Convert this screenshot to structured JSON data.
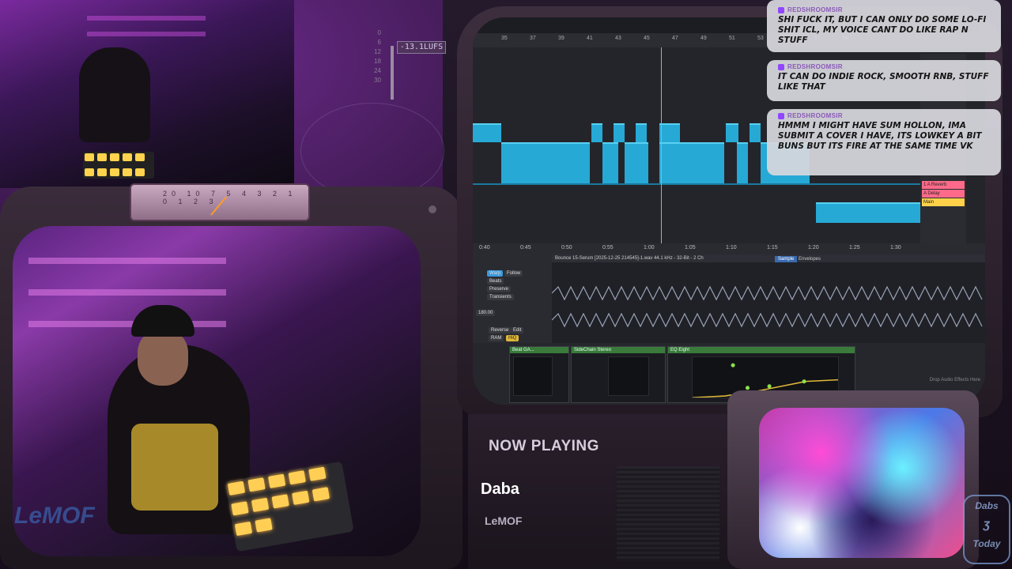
{
  "overlay": {
    "lufs": "-13.1LUFS",
    "meter_scale": [
      "0",
      "6",
      "12",
      "18",
      "24",
      "30",
      "36",
      "42",
      "48",
      "50",
      "54"
    ],
    "watermark": "LeMOF"
  },
  "daw": {
    "ruler_marks": [
      "35",
      "37",
      "39",
      "41",
      "43",
      "45",
      "47",
      "49",
      "51",
      "53",
      "55",
      "57",
      "59"
    ],
    "time_marks": [
      "0:40",
      "0:45",
      "0:50",
      "0:55",
      "1:00",
      "1:05",
      "1:10",
      "1:15",
      "1:20",
      "1:25",
      "1:30"
    ],
    "clip_file": "Bounce 15-Serum [2025-12-25 214545]-1.wav  44.1 kHz - 32-Bit - 2 Ch",
    "clip_tabs": [
      "Sample",
      "Envelopes"
    ],
    "warp_labels": [
      "Warp",
      "Follow",
      "Beats",
      "Preserve",
      "Transients"
    ],
    "bpm": "180.00",
    "buttons": [
      "Reverse",
      "Edit",
      "RAM",
      "HiQ"
    ],
    "devices": [
      {
        "title": "Beat GA...",
        "color": "#3a7a3a"
      },
      {
        "title": "SideChain Stereo",
        "color": "#3a7a3a"
      },
      {
        "title": "EQ Eight",
        "color": "#3a7a3a"
      }
    ],
    "drop_text": "Drop Audio Effects Here",
    "mixer_tracks": [
      "1 A Reverb",
      "A Delay",
      "Main"
    ],
    "mixer_colors": [
      "#ff6a8a",
      "#ff6a8a",
      "#ffd24a"
    ]
  },
  "chat": {
    "messages": [
      {
        "user": "REDSHROOMSIR",
        "text": "SHI FUCK IT, BUT I CAN ONLY DO SOME LO-FI SHIT ICL, MY VOICE CANT DO LIKE RAP N STUFF"
      },
      {
        "user": "REDSHROOMSIR",
        "text": "IT CAN DO INDIE ROCK, SMOOTH RNB, STUFF LIKE THAT"
      },
      {
        "user": "REDSHROOMSIR",
        "text": "HMMM I MIGHT HAVE SUM HOLLON, IMA SUBMIT A COVER I HAVE, ITS LOWKEY A BIT BUNS BUT ITS FIRE AT THE SAME TIME VK"
      }
    ]
  },
  "now_playing": {
    "label": "NOW PLAYING",
    "title": "Daba",
    "artist": "LeMOF"
  },
  "logo": {
    "line1": "Dabs",
    "line2": "Today"
  },
  "vu_meter": {
    "scale": "20 10 7 5 4 3 2 1 0 1 2 3"
  }
}
